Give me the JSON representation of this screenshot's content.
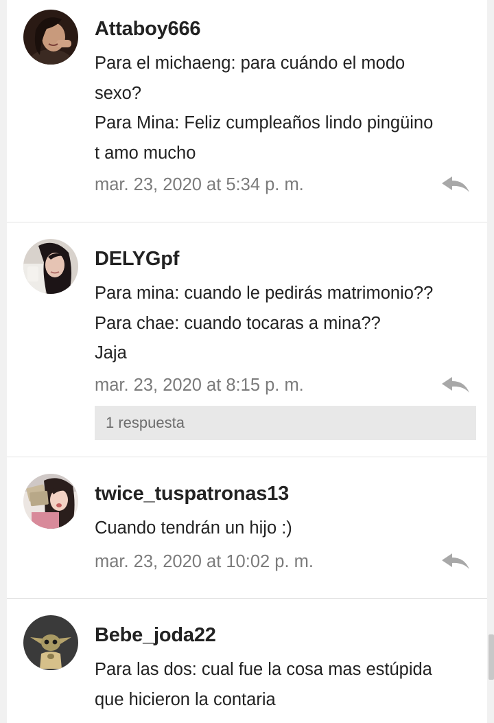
{
  "colors": {
    "background": "#f1f1f1",
    "card": "#ffffff",
    "text": "#222222",
    "timestamp": "#7b7b7b",
    "reply_icon": "#a8a8a8",
    "replies_bar": "#e8e8e8"
  },
  "comments": [
    {
      "username": "Attaboy666",
      "avatar": "user-avatar-photo",
      "lines": [
        "Para el michaeng: para cuándo el modo",
        "sexo?",
        "Para Mina: Feliz cumpleaños lindo pingüino",
        "t amo mucho"
      ],
      "timestamp": "mar. 23, 2020 at 5:34 p. m.",
      "reply_icon": "reply-arrow-icon"
    },
    {
      "username": "DELYGpf",
      "avatar": "user-avatar-photo",
      "lines": [
        "Para mina: cuando le pedirás matrimonio??",
        "Para chae: cuando tocaras a mina??",
        "Jaja"
      ],
      "timestamp": "mar. 23, 2020 at 8:15 p. m.",
      "reply_icon": "reply-arrow-icon",
      "replies_label": "1 respuesta"
    },
    {
      "username": "twice_tuspatronas13",
      "avatar": "user-avatar-photo",
      "lines": [
        "Cuando tendrán un hijo :)"
      ],
      "timestamp": "mar. 23, 2020 at 10:02 p. m.",
      "reply_icon": "reply-arrow-icon"
    },
    {
      "username": "Bebe_joda22",
      "avatar": "user-avatar-photo",
      "lines": [
        "Para las dos: cual fue la cosa mas estúpida",
        "que hicieron la contaria"
      ]
    }
  ]
}
